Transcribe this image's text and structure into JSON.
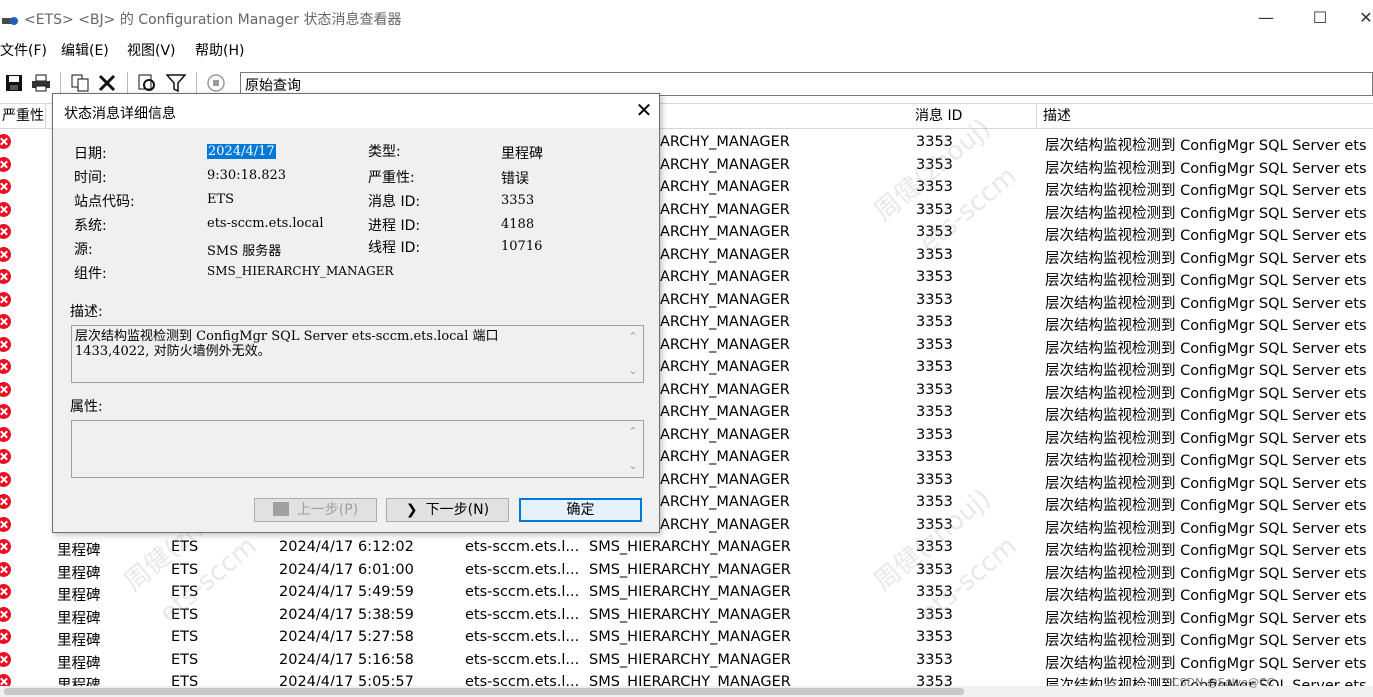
{
  "window": {
    "title": "<ETS> <BJ> 的 Configuration Manager 状态消息查看器",
    "minimize": "—",
    "maximize": "☐",
    "close": "✕"
  },
  "menu": [
    "文件(F)",
    "编辑(E)",
    "视图(V)",
    "帮助(H)"
  ],
  "toolbar": {
    "query_label": "原始查询",
    "icons": [
      "save-icon",
      "print-icon",
      "copy-icon",
      "delete-icon",
      "refresh-icon",
      "filter-icon",
      "stop-icon"
    ]
  },
  "list": {
    "columns": [
      "严重性",
      "消息 ID",
      "描述"
    ],
    "partial_component": "ARCHY_MANAGER",
    "message_id": "3353",
    "description": "层次结构监视检测到 ConfigMgr SQL Server ets",
    "rows": [
      {
        "severity": "里程碑",
        "site": "ETS",
        "date": "2024/4/17 6:12:02",
        "system": "ets-sccm.ets.l...",
        "component": "SMS_HIERARCHY_MANAGER",
        "id": "3353",
        "desc": "层次结构监视检测到 ConfigMgr SQL Server ets"
      },
      {
        "severity": "里程碑",
        "site": "ETS",
        "date": "2024/4/17 6:01:00",
        "system": "ets-sccm.ets.l...",
        "component": "SMS_HIERARCHY_MANAGER",
        "id": "3353",
        "desc": "层次结构监视检测到 ConfigMgr SQL Server ets"
      },
      {
        "severity": "里程碑",
        "site": "ETS",
        "date": "2024/4/17 5:49:59",
        "system": "ets-sccm.ets.l...",
        "component": "SMS_HIERARCHY_MANAGER",
        "id": "3353",
        "desc": "层次结构监视检测到 ConfigMgr SQL Server ets"
      },
      {
        "severity": "里程碑",
        "site": "ETS",
        "date": "2024/4/17 5:38:59",
        "system": "ets-sccm.ets.l...",
        "component": "SMS_HIERARCHY_MANAGER",
        "id": "3353",
        "desc": "层次结构监视检测到 ConfigMgr SQL Server ets"
      },
      {
        "severity": "里程碑",
        "site": "ETS",
        "date": "2024/4/17 5:27:58",
        "system": "ets-sccm.ets.l...",
        "component": "SMS_HIERARCHY_MANAGER",
        "id": "3353",
        "desc": "层次结构监视检测到 ConfigMgr SQL Server ets"
      },
      {
        "severity": "里程碑",
        "site": "ETS",
        "date": "2024/4/17 5:16:58",
        "system": "ets-sccm.ets.l...",
        "component": "SMS_HIERARCHY_MANAGER",
        "id": "3353",
        "desc": "层次结构监视检测到 ConfigMgr SQL Server ets"
      },
      {
        "severity": "里程碑",
        "site": "ETS",
        "date": "2024/4/17 5:05:57",
        "system": "ets-sccm.ets.l...",
        "component": "SMS_HIERARCHY_MANAGER",
        "id": "3353",
        "desc": "层次结构监视检测到 ConfigMgr SQL Server ets"
      }
    ]
  },
  "dialog": {
    "title": "状态消息详细信息",
    "close": "✕",
    "fields_left": [
      {
        "label": "日期:",
        "value": "2024/4/17"
      },
      {
        "label": "时间:",
        "value": "9:30:18.823"
      },
      {
        "label": "站点代码:",
        "value": "ETS"
      },
      {
        "label": "系统:",
        "value": "ets-sccm.ets.local"
      },
      {
        "label": "源:",
        "value": "SMS 服务器"
      },
      {
        "label": "组件:",
        "value": "SMS_HIERARCHY_MANAGER"
      }
    ],
    "fields_right": [
      {
        "label": "类型:",
        "value": "里程碑"
      },
      {
        "label": "严重性:",
        "value": "错误"
      },
      {
        "label": "消息 ID:",
        "value": "3353"
      },
      {
        "label": "进程 ID:",
        "value": "4188"
      },
      {
        "label": "线程 ID:",
        "value": "10716"
      }
    ],
    "description_label": "描述:",
    "description_line1": "层次结构监视检测到 ConfigMgr SQL Server ets-sccm.ets.local 端口",
    "description_line2": "1433,4022, 对防火墙例外无效。",
    "properties_label": "属性:",
    "btn_prev": "上一步(P)",
    "btn_next": "下一步(N)",
    "btn_ok": "确定"
  },
  "watermark": {
    "name": "周健(zhouj)",
    "org": "ets-sccm"
  },
  "overlay_text": "CSDN @Salve@CC"
}
